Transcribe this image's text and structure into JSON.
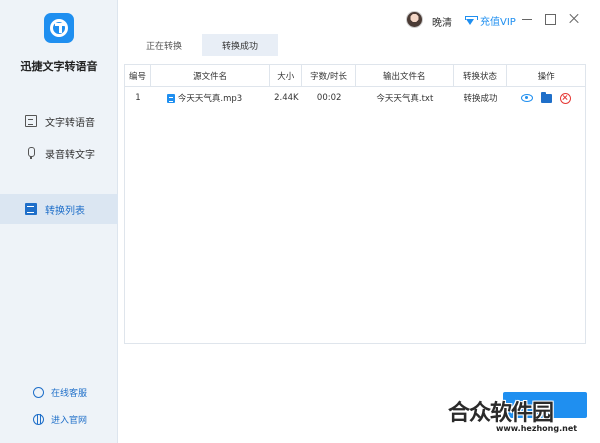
{
  "app": {
    "name": "迅捷文字转语音"
  },
  "sidebar": {
    "items": [
      {
        "label": "文字转语音",
        "icon": "text-doc-icon"
      },
      {
        "label": "录音转文字",
        "icon": "microphone-icon"
      },
      {
        "label": "转换列表",
        "icon": "list-icon"
      }
    ],
    "active_index": 2,
    "footer": [
      {
        "label": "在线客服",
        "icon": "customer-service-icon"
      },
      {
        "label": "进入官网",
        "icon": "globe-icon"
      }
    ]
  },
  "topbar": {
    "username": "晚清",
    "vip_label": "充值VIP"
  },
  "tabs": [
    {
      "label": "正在转换"
    },
    {
      "label": "转换成功"
    }
  ],
  "active_tab": 1,
  "table": {
    "columns": [
      "编号",
      "源文件名",
      "大小",
      "字数/时长",
      "输出文件名",
      "转换状态",
      "操作"
    ],
    "rows": [
      {
        "index": "1",
        "source": "今天天气真.mp3",
        "size": "2.44K",
        "duration": "00:02",
        "output": "今天天气真.txt",
        "status": "转换成功"
      }
    ]
  },
  "watermark": {
    "logo": "合众软件园",
    "url": "www.hezhong.net"
  },
  "colors": {
    "accent": "#1f8ff0",
    "sidebar_bg": "#eef3f8",
    "active_nav": "#1f6fc9",
    "delete": "#e53935"
  }
}
